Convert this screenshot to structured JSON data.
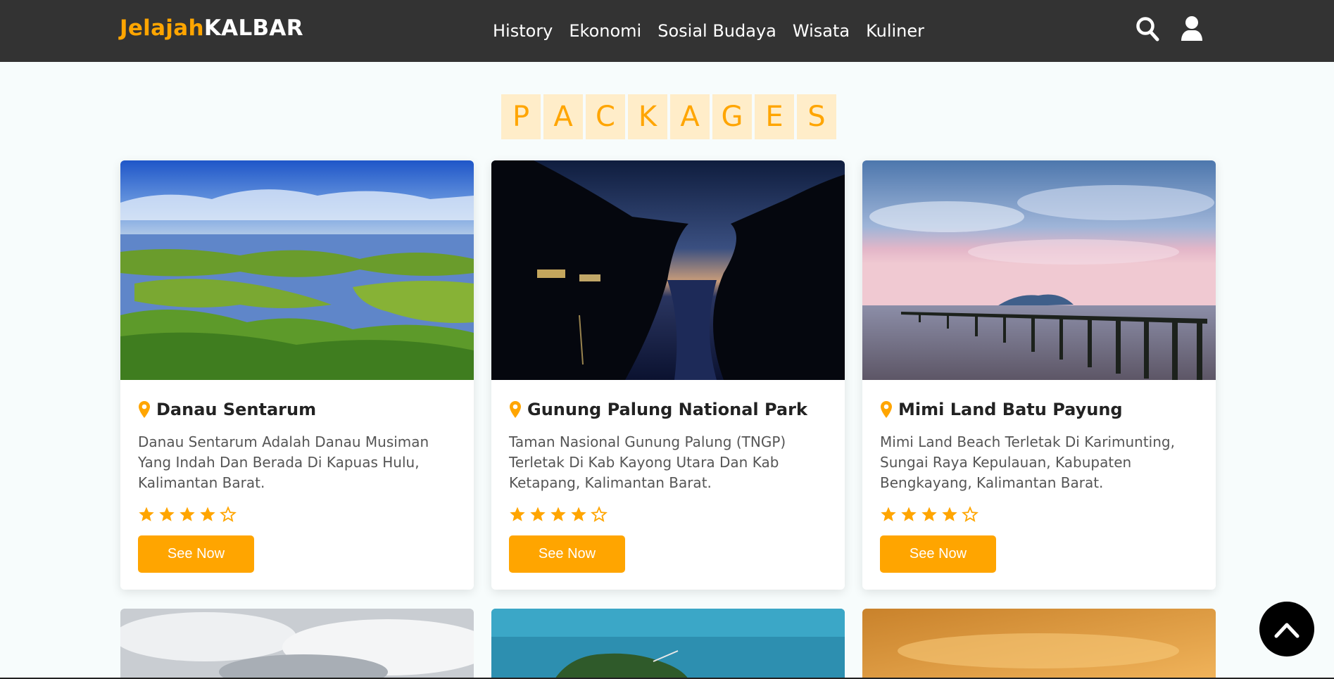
{
  "header": {
    "logo_part1": "Jelajah",
    "logo_part2": "KALBAR",
    "nav": [
      "History",
      "Ekonomi",
      "Sosial Budaya",
      "Wisata",
      "Kuliner"
    ],
    "icons": [
      "search-icon",
      "user-icon"
    ]
  },
  "heading": {
    "letters": [
      "P",
      "A",
      "C",
      "K",
      "A",
      "G",
      "E",
      "S"
    ]
  },
  "packages": [
    {
      "title": "Danau Sentarum",
      "description": "Danau Sentarum Adalah Danau Musiman Yang Indah Dan Berada Di Kapuas Hulu, Kalimantan Barat.",
      "rating": 4,
      "rating_max": 5,
      "button": "See Now"
    },
    {
      "title": "Gunung Palung National Park",
      "description": "Taman Nasional Gunung Palung (TNGP) Terletak Di Kab Kayong Utara Dan Kab Ketapang, Kalimantan Barat.",
      "rating": 4,
      "rating_max": 5,
      "button": "See Now"
    },
    {
      "title": "Mimi Land Batu Payung",
      "description": "Mimi Land Beach Terletak Di Karimunting, Sungai Raya Kepulauan, Kabupaten Bengkayang, Kalimantan Barat.",
      "rating": 4,
      "rating_max": 5,
      "button": "See Now"
    }
  ],
  "colors": {
    "accent": "#ffa500",
    "navbar": "#333333",
    "heading_tile": "#ffedc9"
  }
}
